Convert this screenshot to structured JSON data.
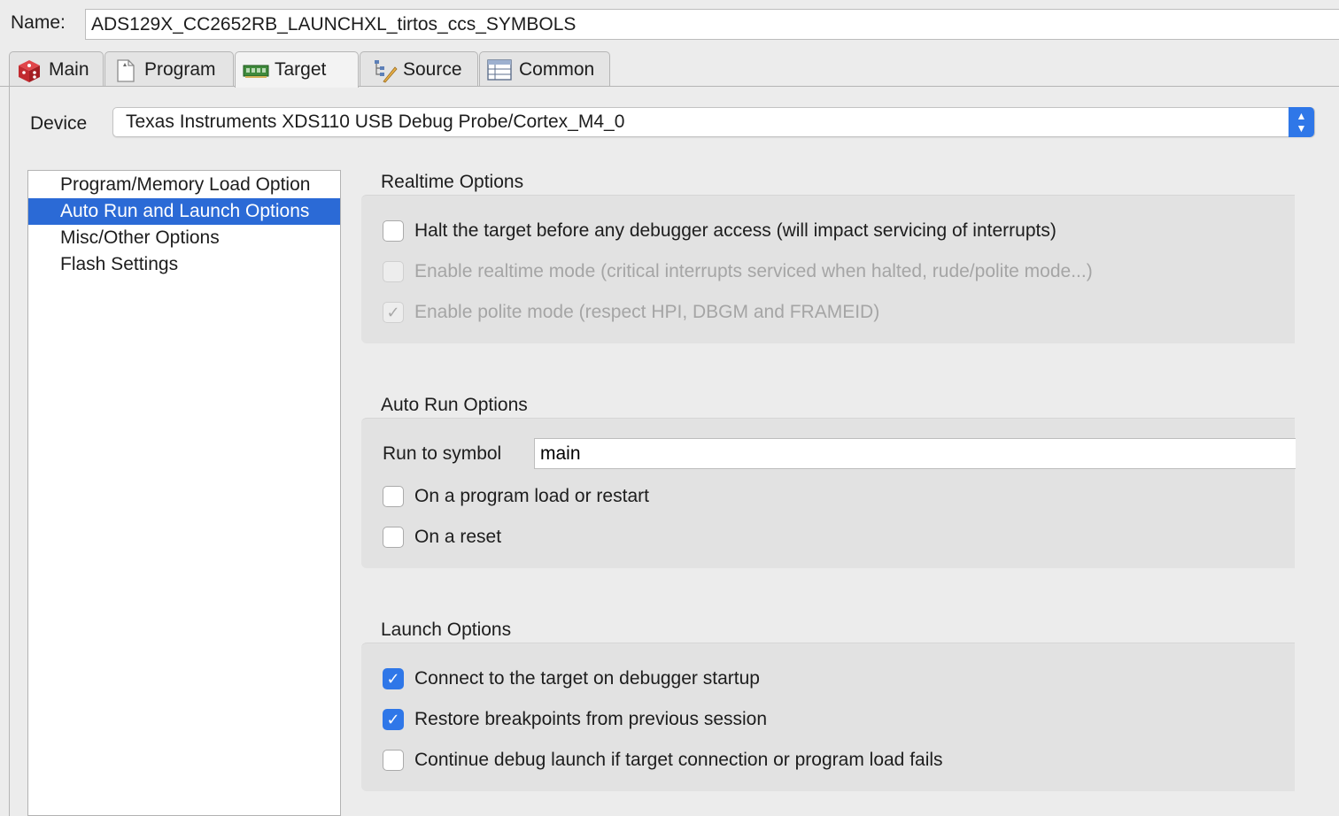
{
  "config": {
    "name_label": "Name:",
    "name_value": "ADS129X_CC2652RB_LAUNCHXL_tirtos_ccs_SYMBOLS"
  },
  "tabs": [
    {
      "label": "Main",
      "icon": "main-cube-icon"
    },
    {
      "label": "Program",
      "icon": "program-file-icon"
    },
    {
      "label": "Target",
      "icon": "target-board-icon",
      "active": true
    },
    {
      "label": "Source",
      "icon": "source-tree-icon"
    },
    {
      "label": "Common",
      "icon": "common-table-icon"
    }
  ],
  "device": {
    "label": "Device",
    "value": "Texas Instruments XDS110 USB Debug Probe/Cortex_M4_0"
  },
  "categories": [
    {
      "label": "Program/Memory Load Option"
    },
    {
      "label": "Auto Run and Launch Options",
      "selected": true
    },
    {
      "label": "Misc/Other Options"
    },
    {
      "label": "Flash Settings"
    }
  ],
  "realtime": {
    "title": "Realtime Options",
    "options": [
      {
        "label": "Halt the target before any debugger access (will impact servicing of interrupts)",
        "checked": false,
        "enabled": true
      },
      {
        "label": "Enable realtime mode (critical interrupts serviced when halted, rude/polite mode...)",
        "checked": false,
        "enabled": false
      },
      {
        "label": "Enable polite mode (respect HPI, DBGM and FRAMEID)",
        "checked": true,
        "enabled": false
      }
    ]
  },
  "autorun": {
    "title": "Auto Run Options",
    "run_label": "Run to symbol",
    "run_value": "main",
    "options": [
      {
        "label": "On a program load or restart",
        "checked": false,
        "enabled": true
      },
      {
        "label": "On a reset",
        "checked": false,
        "enabled": true
      }
    ]
  },
  "launch": {
    "title": "Launch Options",
    "options": [
      {
        "label": "Connect to the target on debugger startup",
        "checked": true,
        "enabled": true
      },
      {
        "label": "Restore breakpoints from previous session",
        "checked": true,
        "enabled": true
      },
      {
        "label": "Continue debug launch if target connection or program load fails",
        "checked": false,
        "enabled": true
      }
    ]
  },
  "colors": {
    "accent": "#2f77e8",
    "selection": "#2b6ad6",
    "group_bg": "#e2e2e2",
    "window_bg": "#ececec"
  }
}
